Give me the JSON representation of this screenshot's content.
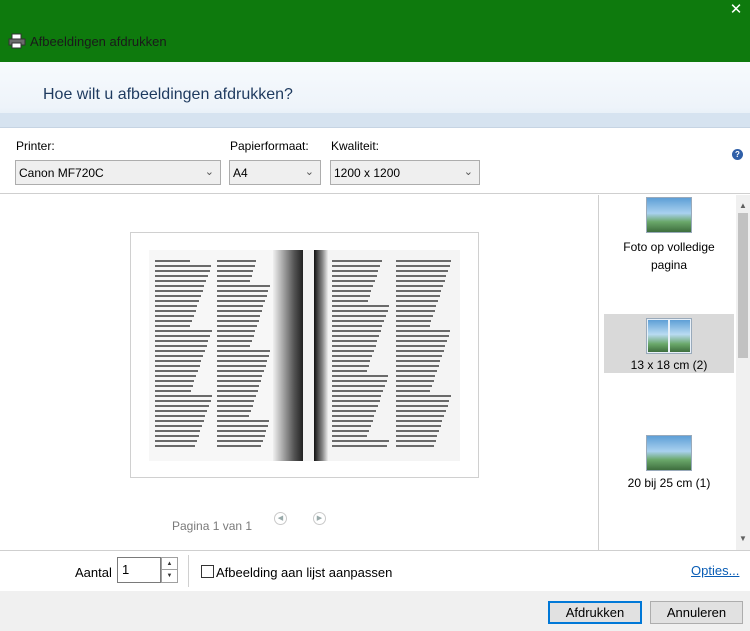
{
  "window": {
    "title": "Afbeeldingen afdrukken",
    "close_symbol": "✕",
    "icon": "printer-icon"
  },
  "header": {
    "question": "Hoe wilt u afbeeldingen afdrukken?"
  },
  "settings": {
    "printer_label": "Printer:",
    "printer_value": "Canon MF720C",
    "paper_label": "Papierformaat:",
    "paper_value": "A4",
    "quality_label": "Kwaliteit:",
    "quality_value": "1200 x 1200",
    "help_symbol": "?"
  },
  "preview": {
    "pager_text": "Pagina 1 van 1",
    "prev_symbol": "◀",
    "next_symbol": "▶"
  },
  "layouts": [
    {
      "label": "Foto op volledige pagina",
      "selected": false
    },
    {
      "label": "13 x 18 cm (2)",
      "selected": true
    },
    {
      "label": "20 bij 25 cm (1)",
      "selected": false
    }
  ],
  "bottom": {
    "count_label": "Aantal",
    "count_value": "1",
    "fit_label": "Afbeelding aan lijst aanpassen",
    "fit_checked": false,
    "options_link": "Opties..."
  },
  "footer": {
    "print_button": "Afdrukken",
    "cancel_button": "Annuleren"
  }
}
